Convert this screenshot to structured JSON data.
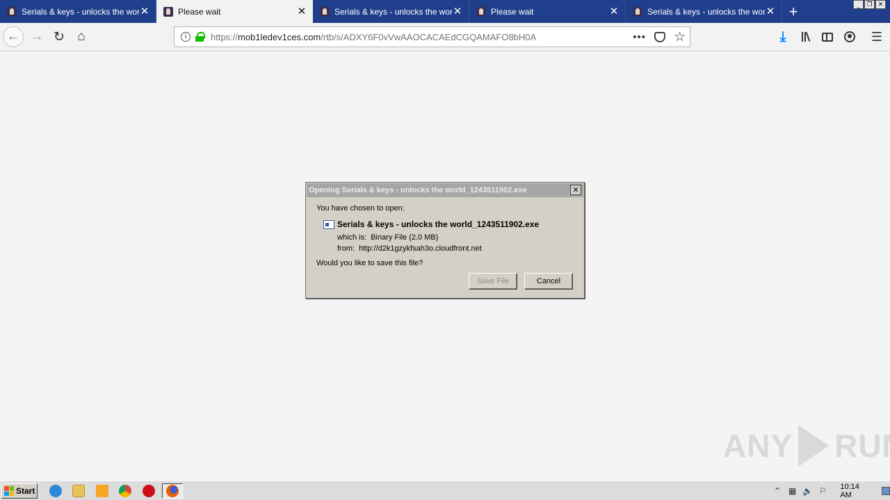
{
  "browser": {
    "tabs": [
      {
        "title": "Serials & keys - unlocks the world",
        "active": false,
        "close": "✕"
      },
      {
        "title": "Please wait",
        "active": true,
        "close": "✕"
      },
      {
        "title": "Serials & keys - unlocks the world",
        "active": false,
        "close": "✕"
      },
      {
        "title": "Please wait",
        "active": false,
        "close": "✕"
      },
      {
        "title": "Serials & keys - unlocks the world",
        "active": false,
        "close": "✕"
      }
    ],
    "new_tab": "+",
    "url": {
      "scheme": "https://",
      "domain": "mob1ledev1ces.com",
      "path": "/rtb/s/ADXY6F0vVwAAOCACAEdCGQAMAFO8bH0A"
    }
  },
  "dialog": {
    "title": "Opening Serials & keys - unlocks the world_1243511902.exe",
    "prompt": "You have chosen to open:",
    "filename": "Serials & keys - unlocks the world_1243511902.exe",
    "which_is_label": "which is:",
    "which_is_value": "Binary File (2.0 MB)",
    "from_label": "from:",
    "from_value": "http://d2k1gzykfsah3o.cloudfront.net",
    "question": "Would you like to save this file?",
    "save_button": "Save File",
    "cancel_button": "Cancel",
    "close": "✕"
  },
  "watermark": {
    "left": "ANY",
    "right": "RUN"
  },
  "taskbar": {
    "start_label": "Start",
    "clock": "10:14 AM"
  },
  "colors": {
    "tabstrip": "#1f3f8c",
    "secure_lock": "#12bc00",
    "download_arrow": "#0a84ff"
  }
}
